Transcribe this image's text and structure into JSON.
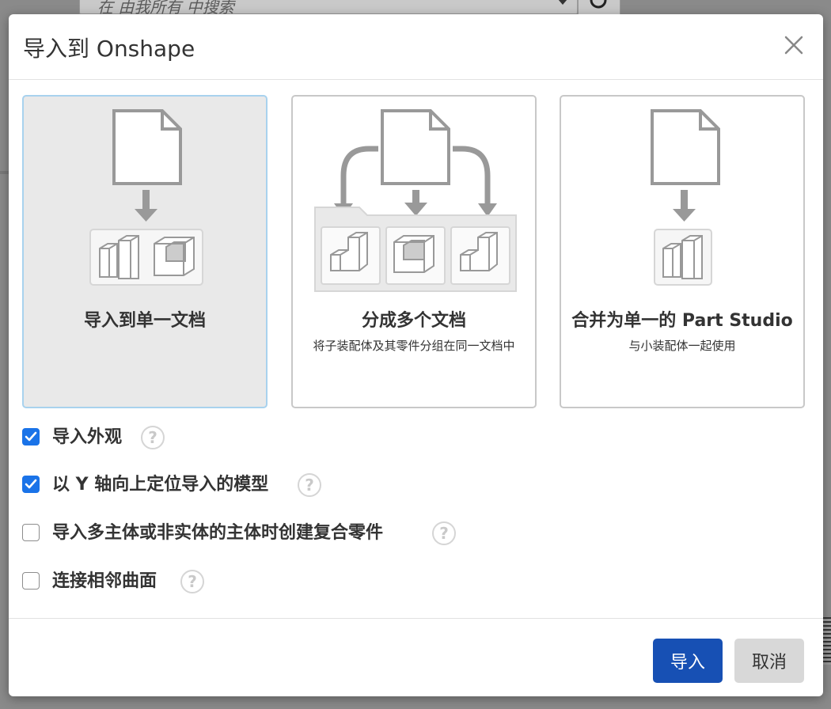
{
  "background": {
    "search_placeholder": "在 由我所有 中搜索"
  },
  "dialog": {
    "title": "导入到 Onshape",
    "close_icon": "close-icon",
    "options_cards": [
      {
        "title": "导入到单一文档",
        "subtitle": "",
        "selected": true
      },
      {
        "title": "分成多个文档",
        "subtitle": "将子装配体及其零件分组在同一文档中",
        "selected": false
      },
      {
        "title": "合并为单一的 Part Studio",
        "subtitle": "与小装配体一起使用",
        "selected": false
      }
    ],
    "checkboxes": [
      {
        "label": "导入外观",
        "checked": true
      },
      {
        "label": "以 Y 轴向上定位导入的模型",
        "checked": true
      },
      {
        "label": "导入多主体或非实体的主体时创建复合零件",
        "checked": false
      },
      {
        "label": "连接相邻曲面",
        "checked": false
      }
    ],
    "help_glyph": "?",
    "buttons": {
      "import_label": "导入",
      "cancel_label": "取消"
    },
    "colors": {
      "accent": "#1750b4",
      "checkbox": "#1a73e8",
      "selected_card_bg": "#e9e9e9",
      "selected_card_border": "#a8d2ee"
    }
  }
}
